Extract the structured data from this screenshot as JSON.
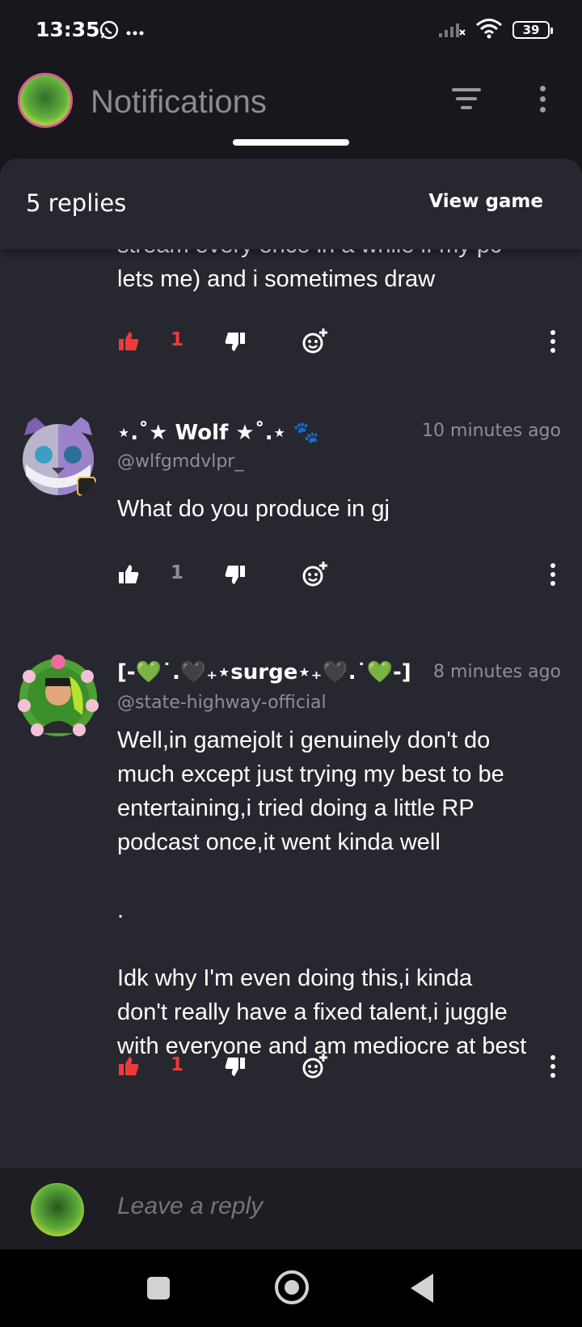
{
  "status": {
    "time": "13:35",
    "battery": "39"
  },
  "header": {
    "title": "Notifications"
  },
  "sheet": {
    "replies_label": "5 replies",
    "view_game_label": "View game"
  },
  "colors": {
    "liked": "#ef3a3a",
    "neutral": "#ffffff",
    "muted": "#8d8e96",
    "sheet_bg": "#272730"
  },
  "comments": [
    {
      "text": "stream every once in a while if my pc\nlets me) and i sometimes draw",
      "like_count": "1",
      "liked": true
    },
    {
      "author": "⋆.˚★ Wolf ★˚.⋆ 🐾",
      "handle": "@wlfgmdvlpr_",
      "time": "10 minutes ago",
      "text": "What do you produce in gj",
      "like_count": "1",
      "liked": false
    },
    {
      "author": "[-💚˙.🖤₊⋆surge⋆₊🖤.˙💚-]",
      "handle": "@state-highway-official",
      "time": "8 minutes ago",
      "text": "Well,in gamejolt i genuinely don't do\nmuch except just trying my best to be\nentertaining,i tried doing a little RP\npodcast once,it went kinda well\n\n.\n\nIdk why I'm even doing this,i kinda\ndon't really have a fixed talent,i juggle\nwith everyone and am mediocre at best",
      "like_count": "1",
      "liked": true
    }
  ],
  "reply": {
    "placeholder": "Leave a reply"
  }
}
